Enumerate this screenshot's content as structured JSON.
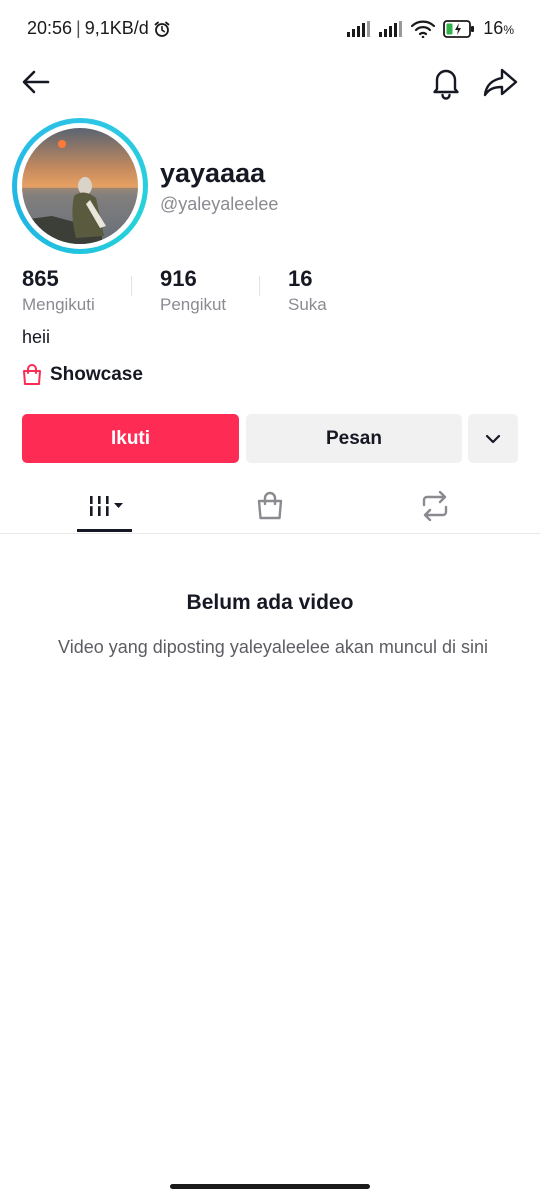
{
  "status_bar": {
    "time": "20:56",
    "speed": "9,1KB/d",
    "battery": "16",
    "battery_unit": "%"
  },
  "profile": {
    "display_name": "yayaaaa",
    "username": "@yaleyaleelee",
    "bio": "heii",
    "showcase_label": "Showcase"
  },
  "stats": [
    {
      "value": "865",
      "label": "Mengikuti"
    },
    {
      "value": "916",
      "label": "Pengikut"
    },
    {
      "value": "16",
      "label": "Suka"
    }
  ],
  "actions": {
    "follow_label": "Ikuti",
    "message_label": "Pesan"
  },
  "tabs": [
    {
      "icon": "grid-icon",
      "selected": true
    },
    {
      "icon": "shopping-bag-icon",
      "selected": false
    },
    {
      "icon": "repost-icon",
      "selected": false
    }
  ],
  "empty_state": {
    "title": "Belum ada video",
    "description": "Video yang diposting yaleyaleelee akan muncul di sini"
  },
  "colors": {
    "accent": "#fe2c55",
    "avatar_ring": "#2ec4e8",
    "secondary_button": "#f1f1f2",
    "muted_text": "#8a8b91"
  }
}
